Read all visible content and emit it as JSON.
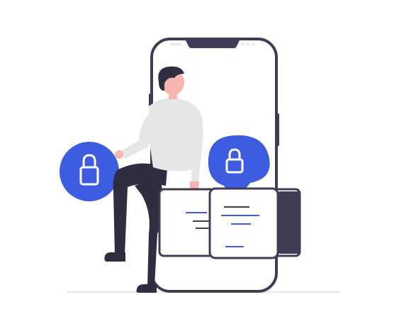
{
  "illustration": {
    "subject": "person-sitting-on-smartphone-with-lock-icons",
    "colors": {
      "accent": "#3d5ce0",
      "phone_outline": "#3f3d56",
      "shirt": "#e6e6e6",
      "skin": "#f5b5b0",
      "hair": "#2f2e41",
      "pants": "#2f2e41",
      "ground": "#e6e6e6",
      "card_fill": "#ffffff"
    },
    "icons": [
      "lock-icon",
      "lock-icon"
    ]
  }
}
